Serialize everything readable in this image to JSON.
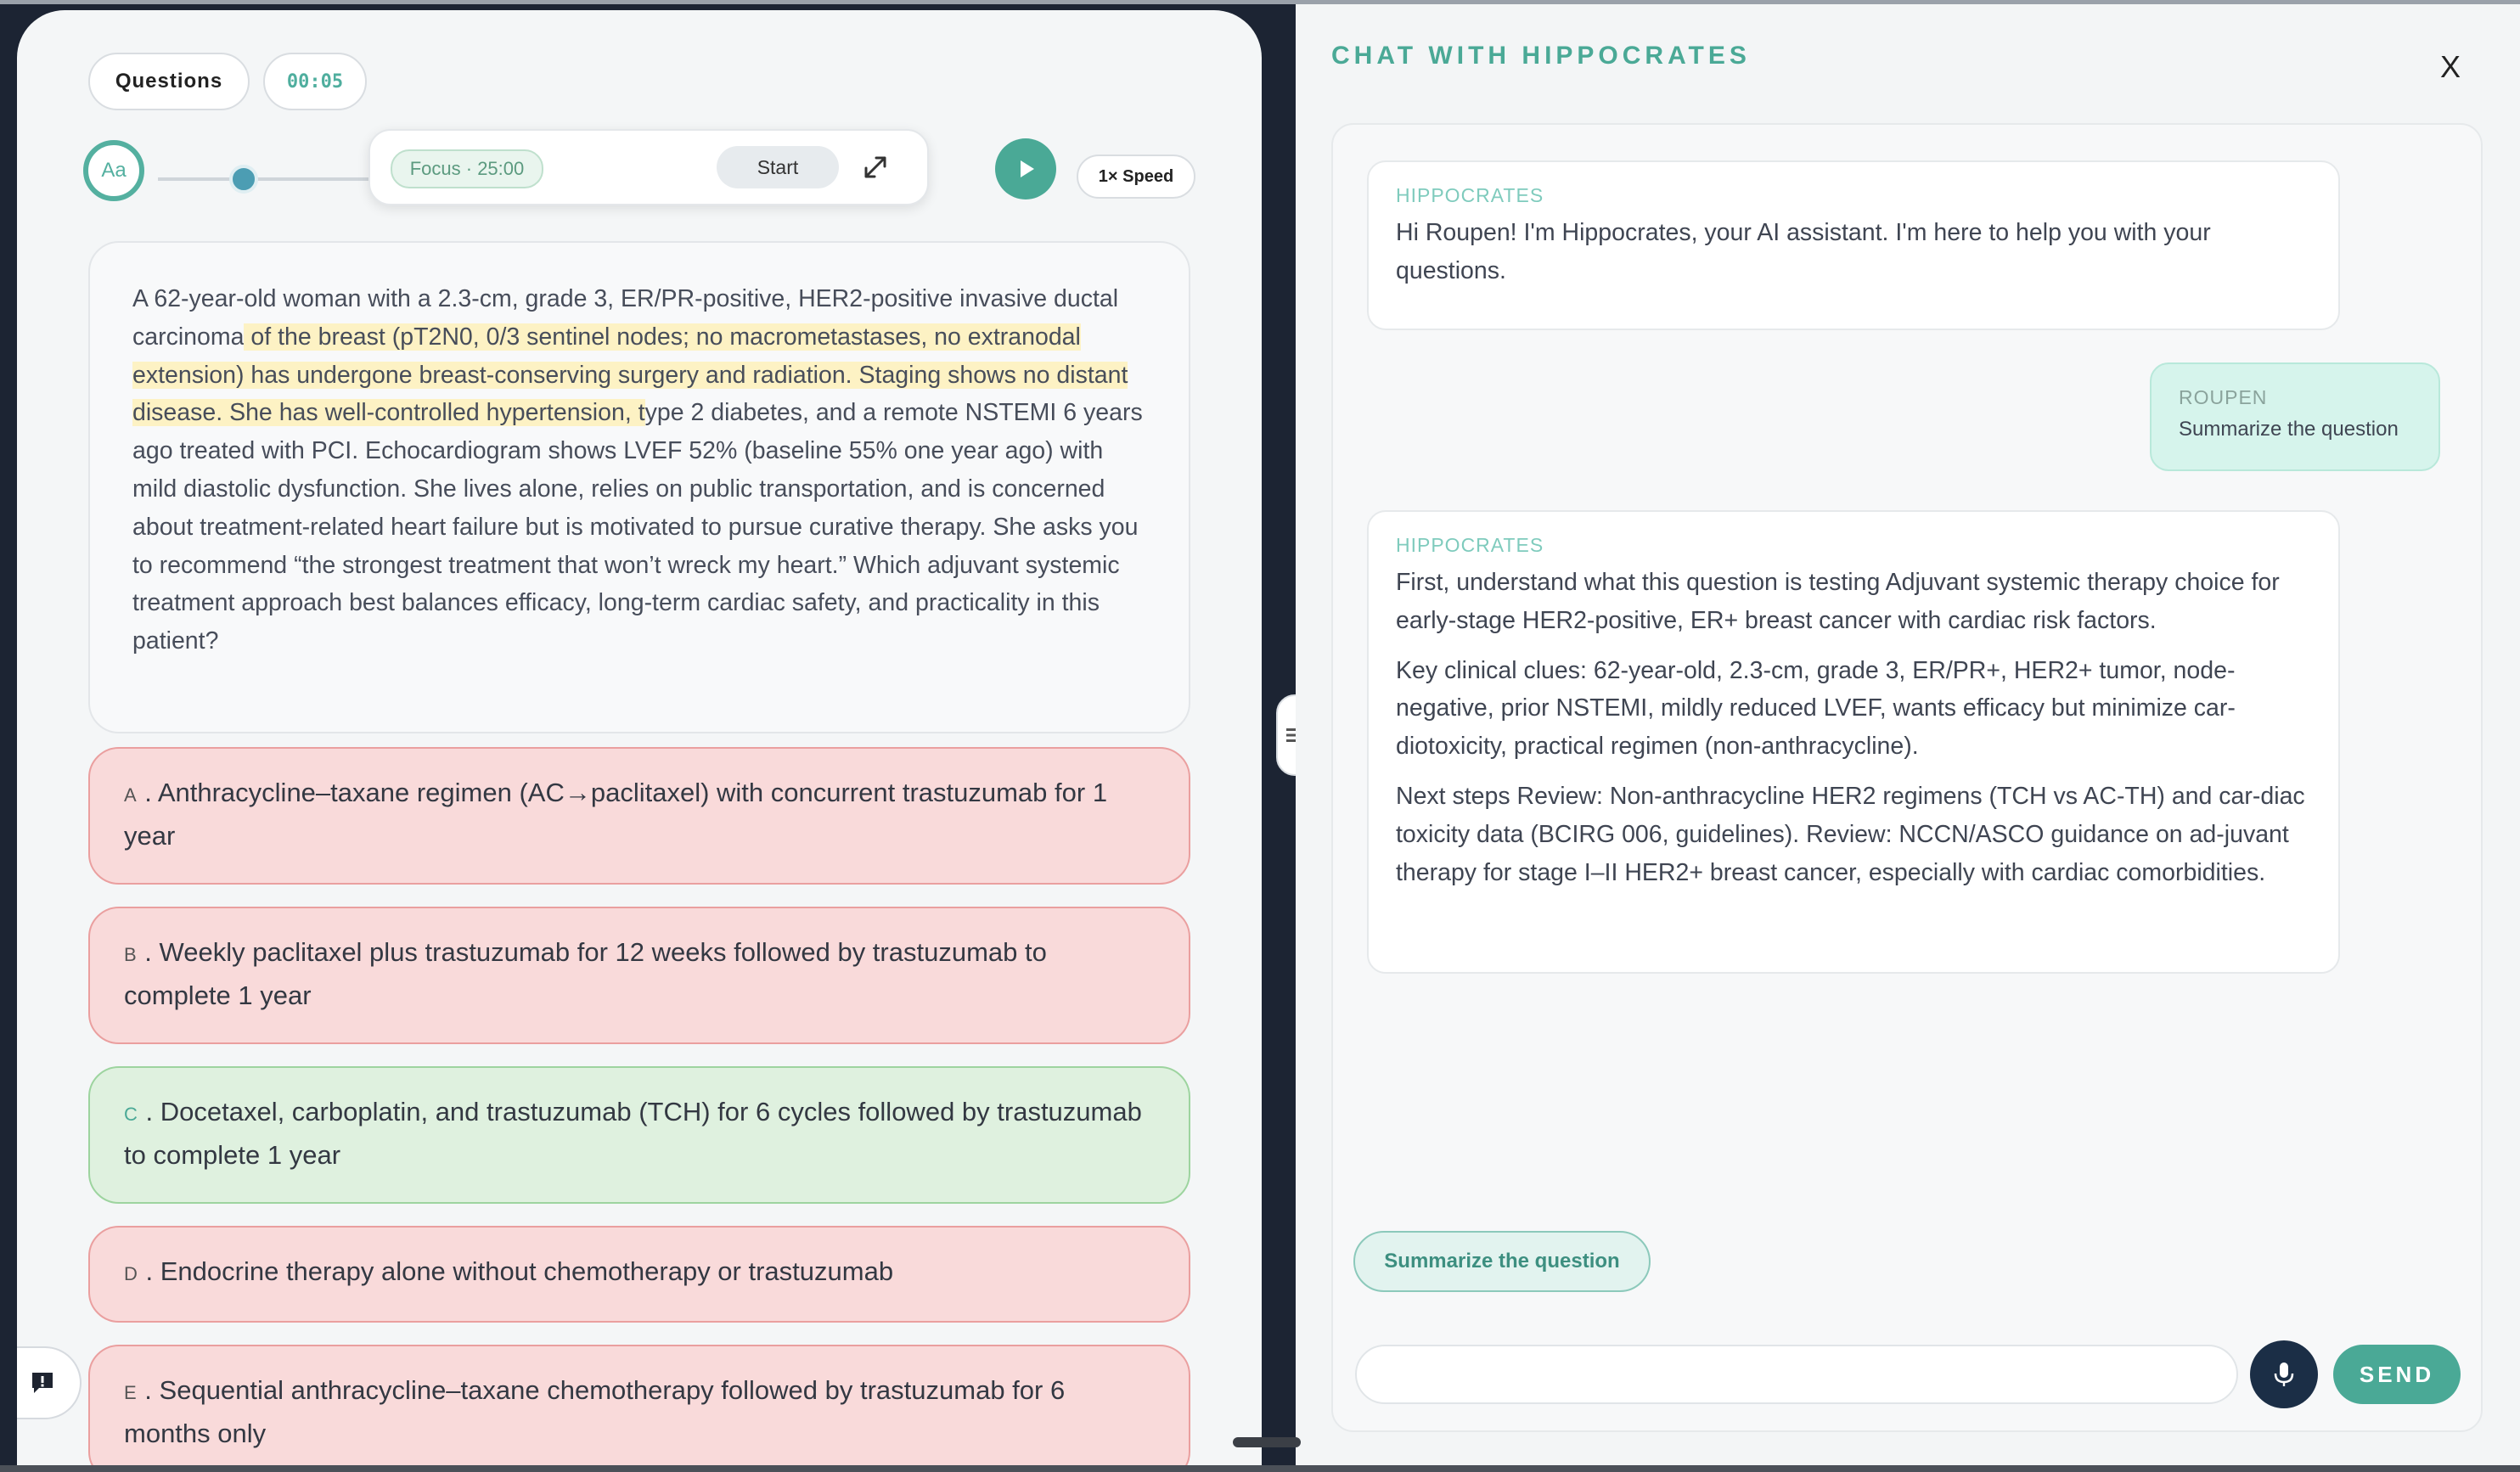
{
  "quiz": {
    "questions_label": "Questions",
    "timer": "00:05",
    "font_button_label": "Aa",
    "focus_badge": "Focus · 25:00",
    "start_label": "Start",
    "speed_label": "1× Speed",
    "question": {
      "part1": "A 62-year-old woman with a 2.3-cm, grade 3, ER/PR-positive, HER2-positive invasive ductal carcinoma",
      "highlighted": " of the breast (pT2N0, 0/3 sentinel nodes; no macrometastases, no extranodal extension) has undergone breast-conserving surgery and radiation. Staging shows no distant disease. She has well-controlled hypertension, t",
      "part2": "ype 2 diabetes, and a remote NSTEMI 6 years ago treated with PCI. Echocardiogram shows LVEF 52% (baseline 55% one year ago) with mild diastolic dysfunction. She lives alone, relies on public transportation, and is concerned about treatment-related heart failure but is motivated to pursue curative therapy. She asks you to recommend “the strongest treatment that won’t wreck my heart.” Which adjuvant systemic treatment approach best balances efficacy, long-term cardiac safety, and practicality in this patient?"
    },
    "options": [
      {
        "letter": "A",
        "text": "Anthracycline–taxane regimen (AC→paclitaxel) with concurrent trastuzumab for 1 year",
        "status": "wrong"
      },
      {
        "letter": "B",
        "text": "Weekly paclitaxel plus trastuzumab for 12 weeks followed by trastuzumab to complete 1 year",
        "status": "wrong"
      },
      {
        "letter": "C",
        "text": "Docetaxel, carboplatin, and trastuzumab (TCH) for 6 cycles followed by trastuzumab to complete 1 year",
        "status": "correct"
      },
      {
        "letter": "D",
        "text": "Endocrine therapy alone without chemotherapy or trastuzumab",
        "status": "wrong"
      },
      {
        "letter": "E",
        "text": "Sequential anthracycline–taxane chemotherapy followed by trastuzumab for 6 months only",
        "status": "wrong"
      }
    ]
  },
  "chat": {
    "title": "CHAT WITH HIPPOCRATES",
    "close_label": "X",
    "messages": [
      {
        "sender": "HIPPOCRATES",
        "paragraphs": [
          "Hi Roupen! I'm Hippocrates, your AI assistant. I'm here to help you with your questions."
        ]
      },
      {
        "sender": "ROUPEN",
        "body": "Summarize the question"
      },
      {
        "sender": "HIPPOCRATES",
        "paragraphs": [
          "First, understand what this question is testing Adjuvant systemic therapy choice for early-stage HER2-positive, ER+ breast cancer with cardiac risk factors.",
          "Key clinical clues: 62-year-old, 2.3-cm, grade 3, ER/PR+, HER2+ tumor, node-negative, prior NSTEMI, mildly reduced LVEF, wants efficacy but minimize car-diotoxicity, practical regimen (non-anthracycline).",
          "Next steps Review: Non-anthracycline HER2 regimens (TCH vs AC-TH) and car-diac toxicity data (BCIRG 006, guidelines). Review: NCCN/ASCO guidance on ad-juvant therapy for stage I–II HER2+ breast cancer, especially with cardiac comorbidities."
        ]
      }
    ],
    "suggestion": "Summarize the question",
    "input_value": "",
    "input_placeholder": "",
    "send_label": "SEND"
  },
  "colors": {
    "accent": "#4aa996",
    "wrong_bg": "#f9dada",
    "correct_bg": "#dff1df",
    "highlight": "#fdf2c4"
  },
  "icons": [
    "expand-icon",
    "play-icon",
    "report-icon",
    "drag-handle-icon",
    "mic-icon"
  ]
}
